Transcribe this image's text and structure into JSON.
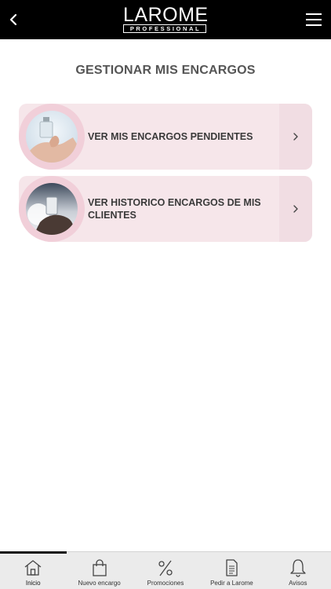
{
  "header": {
    "logo_main": "LAROME",
    "logo_sub": "PROFESSIONAL",
    "back_icon": "chevron-left-icon",
    "menu_icon": "hamburger-menu-icon"
  },
  "page": {
    "title": "GESTIONAR MIS ENCARGOS"
  },
  "cards": [
    {
      "label": "VER MIS ENCARGOS PENDIENTES",
      "photo": "hand-holding-perfume-photo",
      "arrow_icon": "chevron-right-icon"
    },
    {
      "label": "VER HISTORICO ENCARGOS DE MIS CLIENTES",
      "photo": "hand-holding-bottle-photo",
      "arrow_icon": "chevron-right-icon"
    }
  ],
  "tabbar": {
    "active": "Inicio",
    "tabs": [
      {
        "label": "Inicio",
        "icon": "home-icon"
      },
      {
        "label": "Nuevo encargo",
        "icon": "shopping-bag-icon"
      },
      {
        "label": "Promociones",
        "icon": "percent-icon"
      },
      {
        "label": "Pedir a Larome",
        "icon": "document-icon"
      },
      {
        "label": "Avisos",
        "icon": "bell-icon"
      }
    ]
  },
  "colors": {
    "header_bg": "#000000",
    "card_bg": "#f6e6ea",
    "card_circle": "#f1cfd9",
    "title_text": "#555555",
    "tabbar_bg": "#ebebeb"
  }
}
